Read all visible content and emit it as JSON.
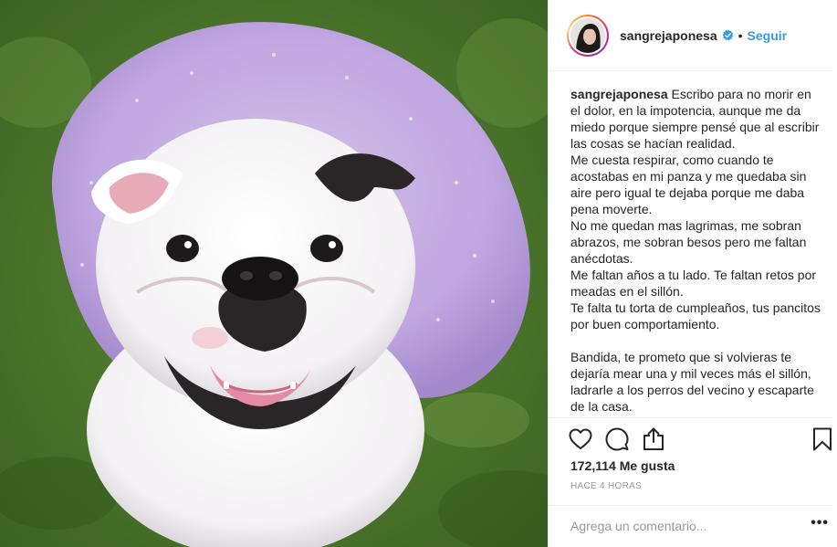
{
  "post": {
    "image_alt": "Bulldog con tutú lila",
    "username": "sangrejaponesa",
    "verified": true,
    "separator": "•",
    "follow_label": "Seguir",
    "caption_user": "sangrejaponesa",
    "caption": " Escribo para no morir en el dolor, en la impotencia, aunque me da miedo porque siempre pensé que al escribir las cosas se hacían realidad.\nMe cuesta respirar, como cuando te acostabas en mi panza y me quedaba sin aire pero igual te dejaba porque me daba pena moverte.\nNo me quedan mas lagrimas, me sobran abrazos, me sobran besos pero me faltan anécdotas.\nMe faltan años a tu lado. Te faltan retos por meadas en el sillón.\nTe falta tu torta de cumpleaños, tus pancitos por buen comportamiento.\n\nBandida, te prometo que si volvieras te dejaría mear una y mil veces más el sillón, ladrarle a los perros del vecino y escaparte de la casa.",
    "likes": "172,114 Me gusta",
    "time": "HACE 4 HORAS",
    "comment_placeholder": "Agrega un comentario...",
    "more_label": "•••"
  },
  "colors": {
    "accent": "#3897f0",
    "text": "#262626",
    "muted": "#999999"
  },
  "icons": [
    "heart-icon",
    "comment-icon",
    "share-icon",
    "bookmark-icon",
    "verified-badge-icon"
  ]
}
